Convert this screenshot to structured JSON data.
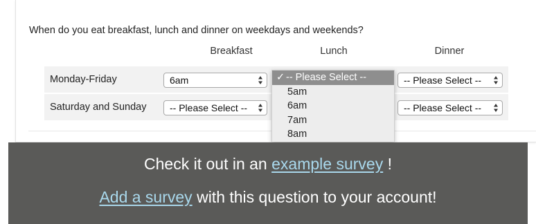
{
  "question": {
    "text": "When do you eat breakfast, lunch and dinner on weekdays and weekends?",
    "columns": [
      "Breakfast",
      "Lunch",
      "Dinner"
    ],
    "rows": [
      {
        "label": "Monday-Friday",
        "breakfast": "6am",
        "dinner": "-- Please Select --"
      },
      {
        "label": "Saturday and Sunday",
        "breakfast": "-- Please Select --",
        "dinner": "-- Please Select --"
      }
    ]
  },
  "dropdown": {
    "selected_mark": "✓",
    "options": [
      "-- Please Select --",
      "5am",
      "6am",
      "7am",
      "8am"
    ]
  },
  "banner": {
    "line1_prefix": "Check it out in an ",
    "line1_link": "example survey",
    "line1_suffix": " !",
    "line2_link": "Add a survey",
    "line2_suffix": " with this question to your account!",
    "background": "#5a5a58",
    "link_color": "#a9d8ec"
  }
}
